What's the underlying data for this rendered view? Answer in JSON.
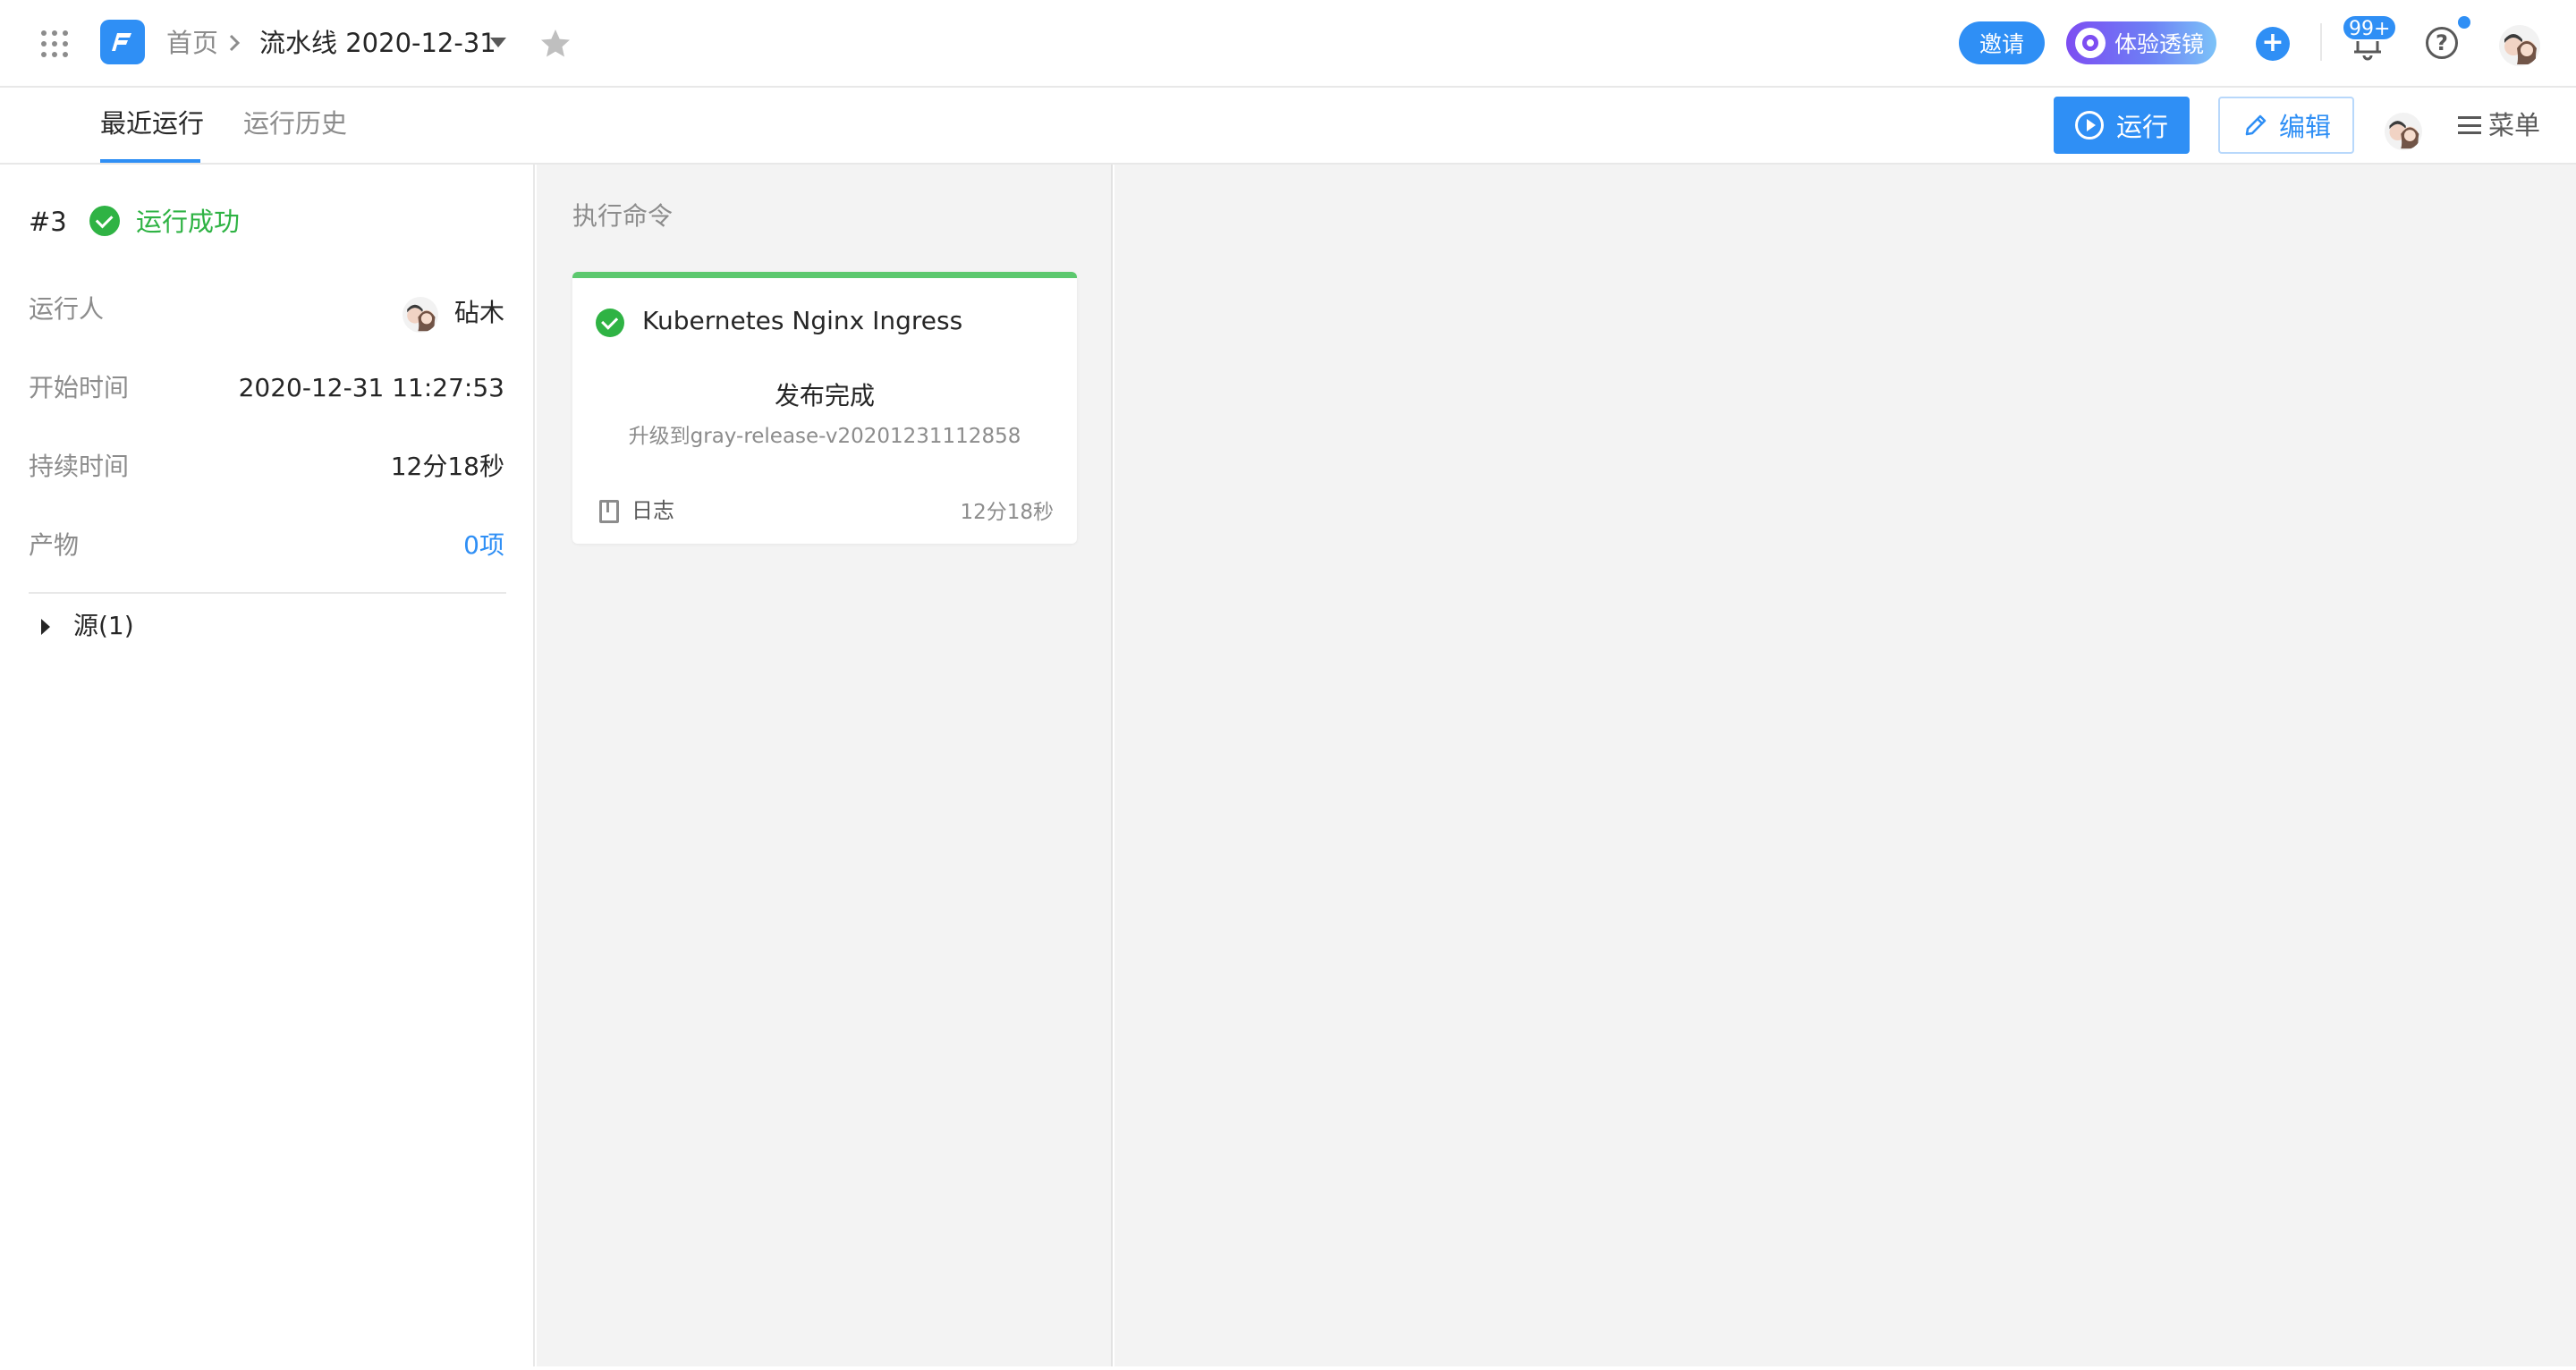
{
  "header": {
    "breadcrumb_home": "首页",
    "pipeline_title": "流水线 2020-12-31",
    "invite_label": "邀请",
    "lens_label": "体验透镜",
    "notification_badge": "99+"
  },
  "subnav": {
    "tabs": [
      {
        "label": "最近运行",
        "active": true
      },
      {
        "label": "运行历史",
        "active": false
      }
    ],
    "run_label": "运行",
    "edit_label": "编辑",
    "menu_label": "菜单"
  },
  "run": {
    "number": "#3",
    "status": "运行成功",
    "fields": [
      {
        "label": "运行人",
        "value": "砧木"
      },
      {
        "label": "开始时间",
        "value": "2020-12-31 11:27:53"
      },
      {
        "label": "持续时间",
        "value": "12分18秒"
      },
      {
        "label": "产物",
        "value": "0项"
      }
    ],
    "source_label": "源(1)"
  },
  "stage": {
    "title": "执行命令",
    "card": {
      "title": "Kubernetes Nginx Ingress",
      "status": "发布完成",
      "detail": "升级到gray-release-v20201231112858",
      "log_label": "日志",
      "duration": "12分18秒"
    }
  },
  "colors": {
    "accent": "#2f8ff5",
    "success": "#2fb344",
    "card_top_border": "#5cc86e",
    "panel_bg": "#f3f3f3"
  },
  "icons": [
    "apps-grid-icon",
    "logo-icon",
    "chevron-right-icon",
    "caret-down-icon",
    "star-icon",
    "plus-icon",
    "bell-icon",
    "help-icon",
    "play-circle-icon",
    "pencil-icon",
    "menu-icon",
    "check-circle-icon",
    "caret-right-icon",
    "log-book-icon"
  ]
}
